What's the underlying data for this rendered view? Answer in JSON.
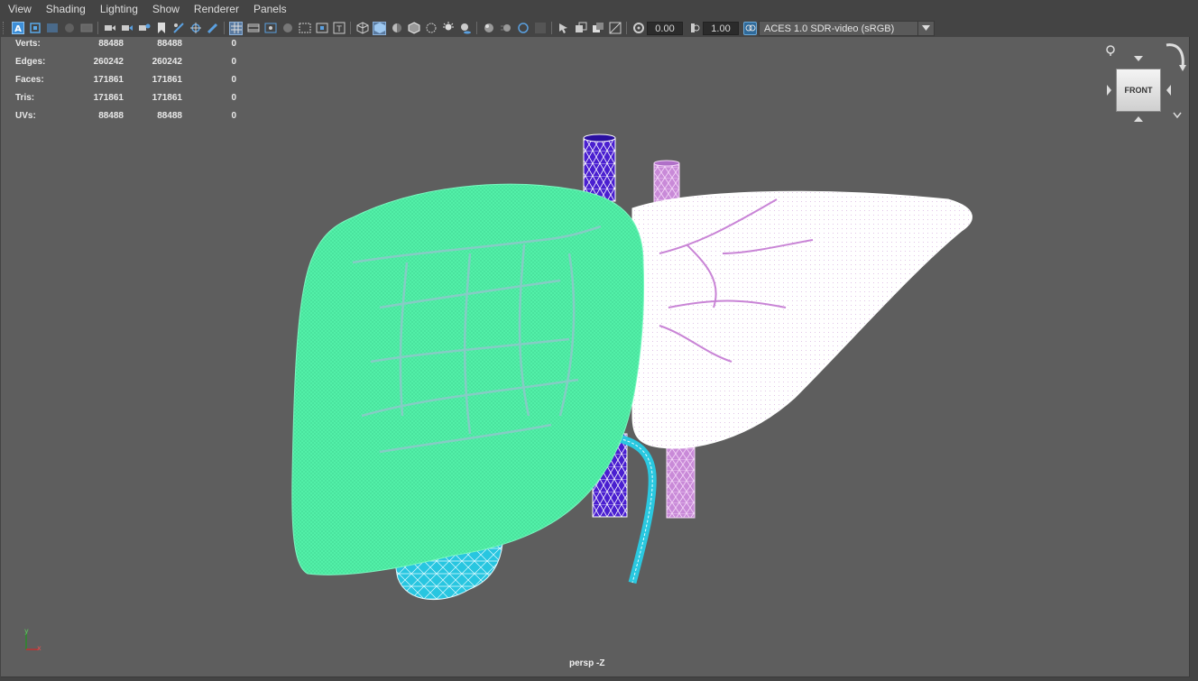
{
  "menubar": {
    "items": [
      "View",
      "Shading",
      "Lighting",
      "Show",
      "Renderer",
      "Panels"
    ]
  },
  "toolbar": {
    "exposure_value": "0.00",
    "gamma_value": "1.00",
    "color_space": "ACES 1.0 SDR-video (sRGB)"
  },
  "stats": {
    "rows": [
      {
        "label": "Verts:",
        "v1": "88488",
        "v2": "88488",
        "v3": "0"
      },
      {
        "label": "Edges:",
        "v1": "260242",
        "v2": "260242",
        "v3": "0"
      },
      {
        "label": "Faces:",
        "v1": "171861",
        "v2": "171861",
        "v3": "0"
      },
      {
        "label": "Tris:",
        "v1": "171861",
        "v2": "171861",
        "v3": "0"
      },
      {
        "label": "UVs:",
        "v1": "88488",
        "v2": "88488",
        "v3": "0"
      }
    ]
  },
  "viewcube": {
    "face_label": "FRONT"
  },
  "viewport": {
    "camera_label": "persp -Z"
  },
  "axis": {
    "y_label": "y",
    "x_label": "x"
  },
  "colors": {
    "viewport_bg": "#5e5e5e",
    "liver_right_lobe": "#4df2a6",
    "liver_left_lobe": "#ffffff",
    "portal_vein": "#b077c8",
    "ivc": "#4a1fd0",
    "gallbladder": "#2ac8e0",
    "bile_duct": "#40d8e8"
  }
}
